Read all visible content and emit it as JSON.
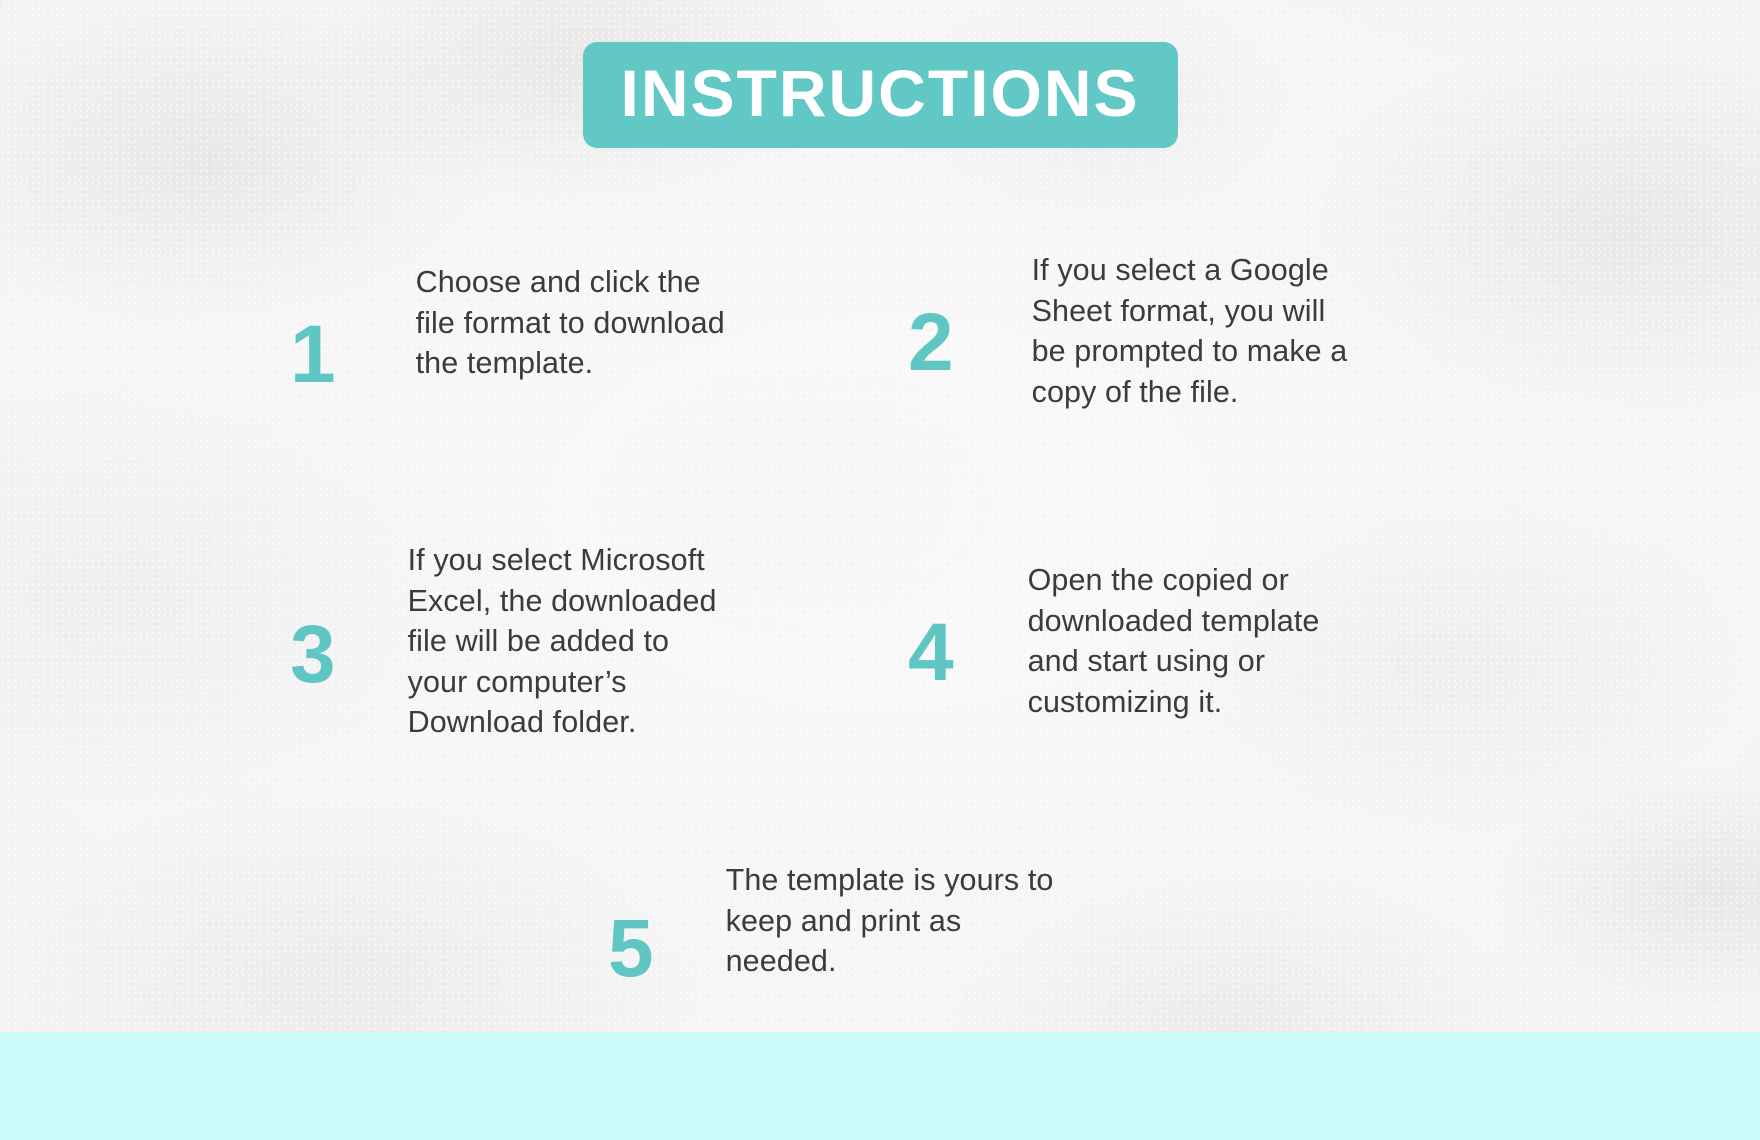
{
  "page": {
    "title": "INSTRUCTIONS",
    "background_color": "#f4f3f3",
    "accent_color": "#62c8c6",
    "number_color": "#5fc6c3",
    "text_color": "#3b3b3b",
    "bottom_band_color": "#cdfbf9"
  },
  "steps": [
    {
      "number": "1",
      "text": "Choose and click the\nfile format to download\nthe template."
    },
    {
      "number": "2",
      "text": "If you select a Google\nSheet format, you will\nbe prompted to make a\ncopy of the file."
    },
    {
      "number": "3",
      "text": "If you select Microsoft\nExcel, the downloaded\nfile will be added to\nyour computer’s\nDownload  folder."
    },
    {
      "number": "4",
      "text": "Open the copied or\ndownloaded template\nand start using or\ncustomizing it."
    },
    {
      "number": "5",
      "text": "The template is yours to\nkeep and print as\nneeded."
    }
  ]
}
